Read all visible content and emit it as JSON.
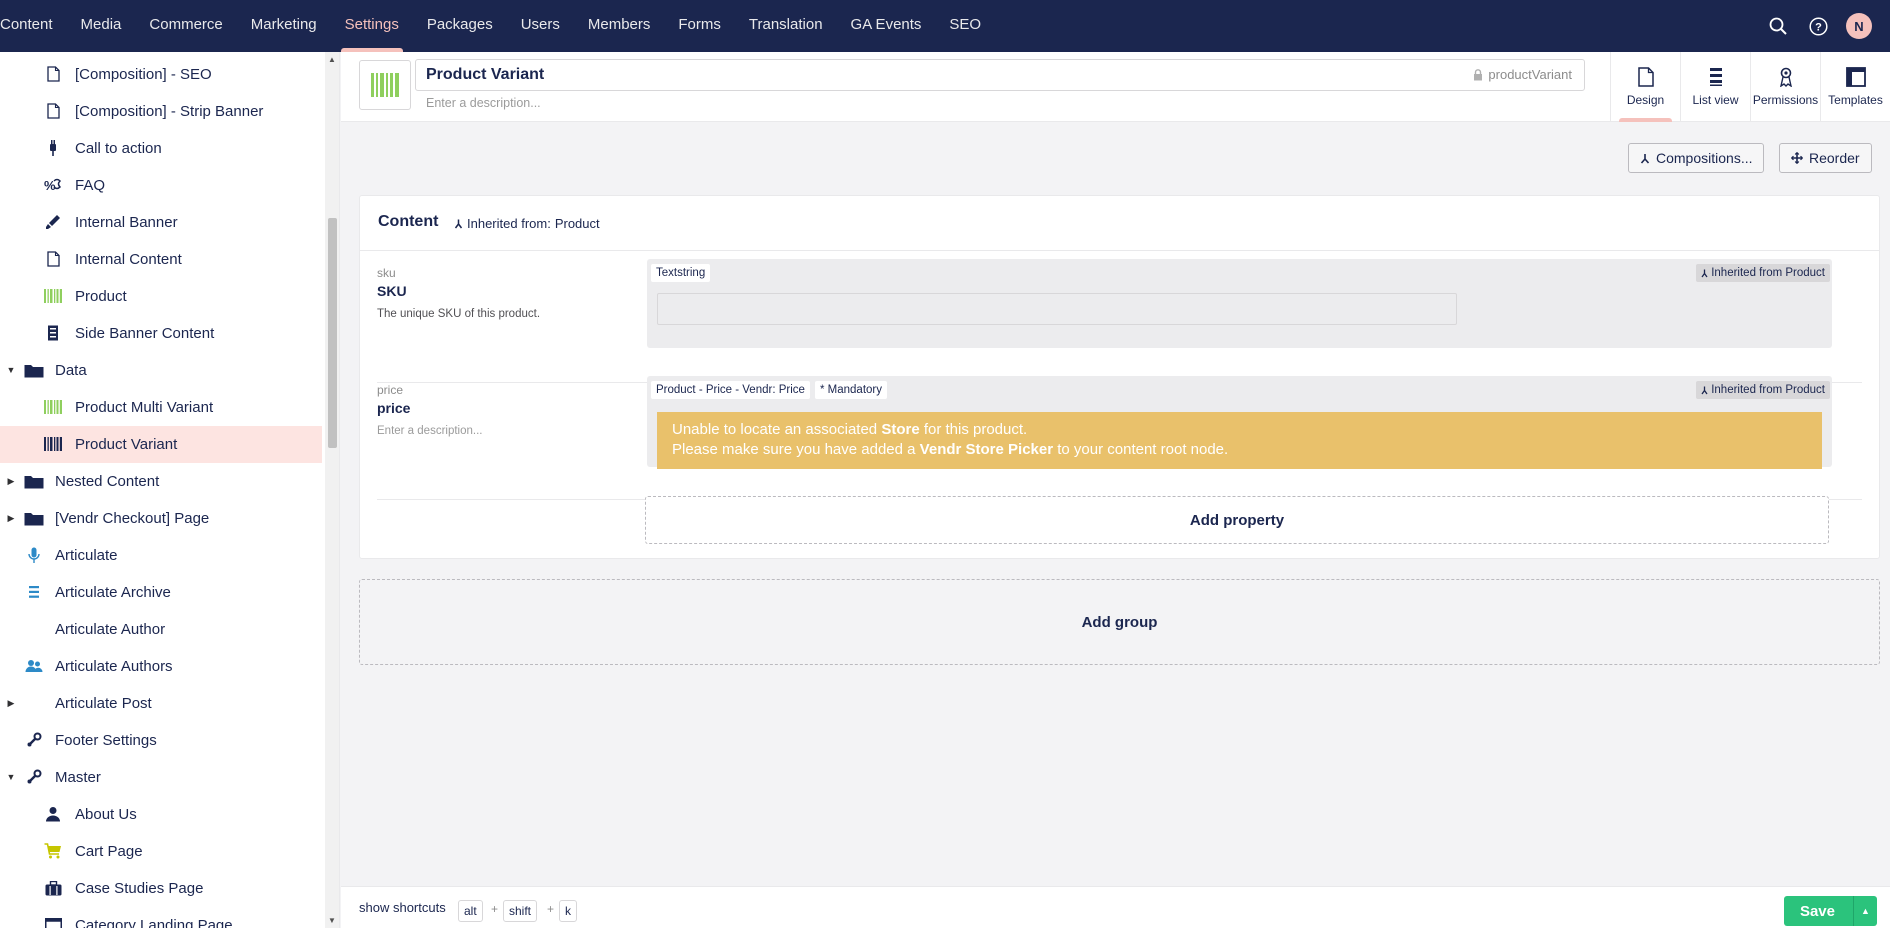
{
  "nav": {
    "items": [
      "Content",
      "Media",
      "Commerce",
      "Marketing",
      "Settings",
      "Packages",
      "Users",
      "Members",
      "Forms",
      "Translation",
      "GA Events",
      "SEO"
    ],
    "active": "Settings",
    "avatar": "N"
  },
  "tree": [
    {
      "label": "[Composition] - SEO",
      "icon": "document-icon",
      "level": 2,
      "caret": ""
    },
    {
      "label": "[Composition] - Strip Banner",
      "icon": "document-icon",
      "level": 2,
      "caret": ""
    },
    {
      "label": "Call to action",
      "icon": "plug-icon",
      "level": 2,
      "caret": ""
    },
    {
      "label": "FAQ",
      "icon": "faq-icon",
      "level": 2,
      "caret": ""
    },
    {
      "label": "Internal Banner",
      "icon": "brush-icon",
      "level": 2,
      "caret": ""
    },
    {
      "label": "Internal Content",
      "icon": "document-icon",
      "level": 2,
      "caret": ""
    },
    {
      "label": "Product",
      "icon": "barcode-icon",
      "level": 2,
      "caret": ""
    },
    {
      "label": "Side Banner Content",
      "icon": "column-icon",
      "level": 2,
      "caret": ""
    },
    {
      "label": "Data",
      "icon": "folder-icon",
      "level": 1,
      "caret": "down"
    },
    {
      "label": "Product Multi Variant",
      "icon": "barcode-icon",
      "level": 2,
      "caret": ""
    },
    {
      "label": "Product Variant",
      "icon": "barcode-icon",
      "level": 2,
      "caret": "",
      "selected": true
    },
    {
      "label": "Nested Content",
      "icon": "folder-icon",
      "level": 1,
      "caret": "right"
    },
    {
      "label": "[Vendr Checkout] Page",
      "icon": "folder-icon",
      "level": 1,
      "caret": "right"
    },
    {
      "label": "Articulate",
      "icon": "microphone-icon",
      "level": 1,
      "caret": ""
    },
    {
      "label": "Articulate Archive",
      "icon": "list-icon",
      "level": 1,
      "caret": ""
    },
    {
      "label": "Articulate Author",
      "icon": "",
      "level": 1,
      "caret": ""
    },
    {
      "label": "Articulate Authors",
      "icon": "users-icon",
      "level": 1,
      "caret": ""
    },
    {
      "label": "Articulate Post",
      "icon": "",
      "level": 1,
      "caret": "right"
    },
    {
      "label": "Footer Settings",
      "icon": "settings-icon",
      "level": 1,
      "caret": ""
    },
    {
      "label": "Master",
      "icon": "settings-icon",
      "level": 1,
      "caret": "down"
    },
    {
      "label": "About Us",
      "icon": "user-icon",
      "level": 2,
      "caret": ""
    },
    {
      "label": "Cart Page",
      "icon": "cart-icon",
      "level": 2,
      "caret": ""
    },
    {
      "label": "Case Studies Page",
      "icon": "briefcase-icon",
      "level": 2,
      "caret": ""
    },
    {
      "label": "Category Landing Page",
      "icon": "window-icon",
      "level": 2,
      "caret": ""
    }
  ],
  "header": {
    "name": "Product Variant",
    "alias": "productVariant",
    "description_placeholder": "Enter a description...",
    "tabs": [
      {
        "label": "Design",
        "icon": "document-icon",
        "active": true
      },
      {
        "label": "List view",
        "icon": "list-icon",
        "active": false
      },
      {
        "label": "Permissions",
        "icon": "permissions-icon",
        "active": false
      },
      {
        "label": "Templates",
        "icon": "templates-icon",
        "active": false
      }
    ]
  },
  "toolbar": {
    "compositions_label": "Compositions...",
    "reorder_label": "Reorder"
  },
  "group": {
    "title": "Content",
    "inherited_label": "Inherited from:",
    "inherited_value": "Product",
    "properties": [
      {
        "alias": "sku",
        "name": "SKU",
        "description": "The unique SKU of this product.",
        "editor": "Textstring",
        "inherited": "Inherited from Product"
      },
      {
        "alias": "price",
        "name": "price",
        "description": "Enter a description...",
        "editor": "Product - Price - Vendr: Price",
        "mandatory": "* Mandatory",
        "inherited": "Inherited from Product",
        "warning_line1_pre": "Unable to locate an associated ",
        "warning_line1_bold": "Store",
        "warning_line1_post": " for this product.",
        "warning_line2_pre": "Please make sure you have added a ",
        "warning_line2_bold": "Vendr Store Picker",
        "warning_line2_post": " to your content root node."
      }
    ],
    "add_property_label": "Add property"
  },
  "add_group_label": "Add group",
  "footer": {
    "shortcuts_label": "show shortcuts",
    "keys": [
      "alt",
      "shift",
      "k"
    ],
    "plus": "+",
    "save_label": "Save"
  },
  "colors": {
    "nav_bg": "#1b264f",
    "accent": "#f5c1bc",
    "save": "#2bc37c",
    "warning": "#e9c16b",
    "selected_row": "#fde4e1"
  }
}
